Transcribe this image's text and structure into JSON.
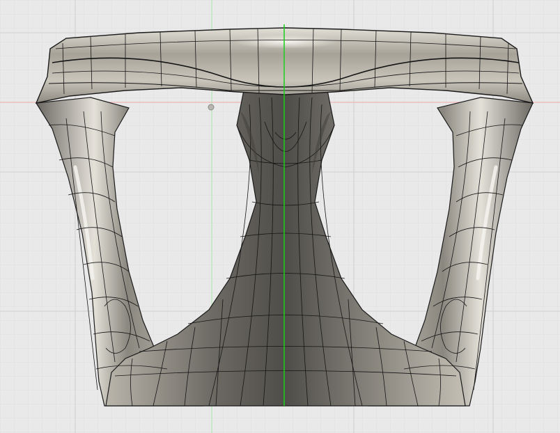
{
  "viewport": {
    "background_color": "#e9e9e9",
    "grid_minor_color": "#dedede",
    "grid_major_color": "#cfcfcf",
    "axis_x_color": "#f0a8a8",
    "axis_y_color": "#19d119",
    "axis_y_faint_color": "#a8e4a8"
  },
  "model": {
    "surface_light": "#cfcbc0",
    "surface_mid": "#9a968b",
    "surface_dark": "#55524c",
    "wire_color": "#151515",
    "edge_color": "#1a1a1a"
  }
}
